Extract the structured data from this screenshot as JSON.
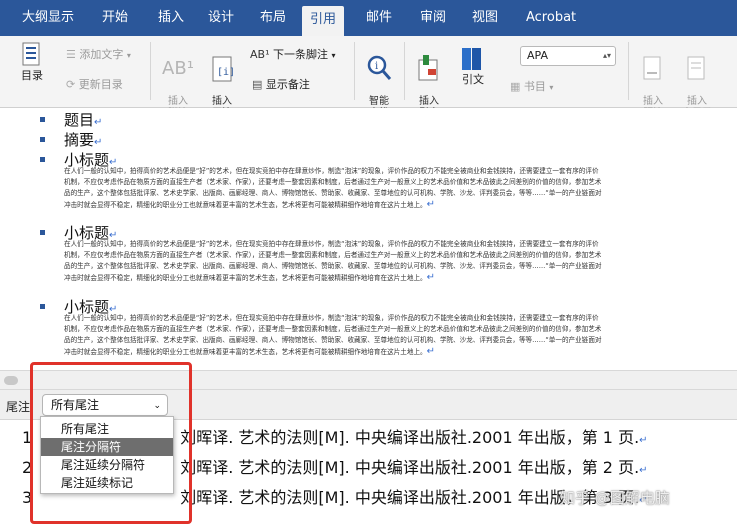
{
  "tabs": [
    {
      "label": "大纲显示"
    },
    {
      "label": "开始"
    },
    {
      "label": "插入"
    },
    {
      "label": "设计"
    },
    {
      "label": "布局"
    },
    {
      "label": "引用"
    },
    {
      "label": "邮件"
    },
    {
      "label": "审阅"
    },
    {
      "label": "视图"
    },
    {
      "label": "Acrobat"
    }
  ],
  "ribbon": {
    "toc_label": "目录",
    "add_text": "添加文字",
    "update_toc": "更新目录",
    "insert_footnote": "插入\n脚注",
    "insert_endnote": "插入\n尾注",
    "next_footnote": "下一条脚注",
    "show_notes": "显示备注",
    "smart_lookup": "智能\n查找",
    "insert_citation": "插入\n引文",
    "citation": "引文",
    "style": "APA",
    "bibliography": "书目",
    "insert_caption": "插入\n题注",
    "insert_tof": "插入\n表目录"
  },
  "doc": {
    "title": "题目",
    "abstract": "摘要",
    "subheading": "小标题",
    "paragraph": "在人们一般的认知中，拍得高价的艺术品便是“好”的艺术，但在现实竞拍中存在肆意炒作，制造“泡沫”的现象，评价作品的权力不能完全被商业和金钱挟持，还需要建立一套有序的评价机制，不应仅考虑作品在物质方面的直接生产者（艺术家、作家），还要考虑一整套因素和制度，后者通过生产对一般意义上的艺术品价值和艺术品彼此之间差别的价值的信仰，参加艺术品的生产，这个整体包括批评家、艺术史学家、出版商、画廊经理、商人、博物馆馆长、赞助家、收藏家、至尊地位的认可机构、学院、沙龙、评判委员会，等等……“单一的产业链面对冲击时就会显得不稳定，精细化的职业分工也就意味着更丰富的艺术生态，艺术将更有可能被精耕细作地培育在这片土地上。"
  },
  "pane": {
    "label": "尾注",
    "combo_value": "所有尾注",
    "menu": [
      "所有尾注",
      "尾注分隔符",
      "尾注延续分隔符",
      "尾注延续标记"
    ],
    "notes": [
      "刘晖译. 艺术的法则[M]. 中央编译出版社.2001 年出版，第 1 页.",
      "刘晖译. 艺术的法则[M]. 中央编译出版社.2001 年出版，第 2 页.",
      "刘晖译. 艺术的法则[M]. 中央编译出版社.2001 年出版，第 3 页."
    ],
    "watermark": "知乎 @图解电脑"
  },
  "colors": {
    "brand": "#2b579a",
    "highlight": "#e0322a"
  }
}
